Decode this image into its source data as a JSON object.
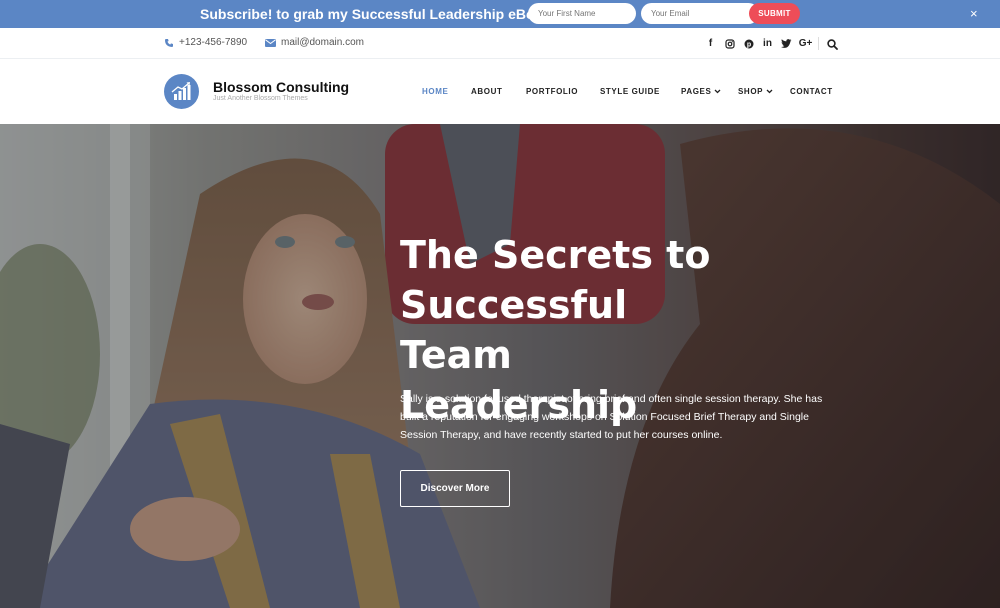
{
  "subscribe": {
    "message": "Subscribe! to grab my Successful Leadership eBook!",
    "first_name_placeholder": "Your First Name",
    "email_placeholder": "Your Email",
    "submit_label": "SUBMIT",
    "close_symbol": "×"
  },
  "contact": {
    "phone": "+123-456-7890",
    "email": "mail@domain.com",
    "socials": [
      "facebook-icon",
      "instagram-icon",
      "pinterest-icon",
      "linkedin-icon",
      "twitter-icon",
      "google-plus-icon"
    ],
    "social_glyphs": [
      "f",
      "◎",
      "℗",
      "in",
      "🐦",
      "G+"
    ]
  },
  "header": {
    "site_title": "Blossom Consulting",
    "tagline": "Just Another Blossom Themes",
    "nav": [
      "HOME",
      "ABOUT",
      "PORTFOLIO",
      "STYLE GUIDE",
      "PAGES",
      "SHOP",
      "CONTACT"
    ],
    "active": "HOME"
  },
  "hero": {
    "title_lines": [
      "The Secrets to",
      "Successful Team",
      "Leadership"
    ],
    "description": "Sally is a solution focused therapist offering brief and often single session therapy. She has built a reputation for engaging workshops on Solution Focused Brief Therapy and Single Session Therapy, and have recently started to put her courses online.",
    "button_label": "Discover More"
  },
  "colors": {
    "accent": "#5b86c5",
    "submit": "#ee4d58"
  }
}
